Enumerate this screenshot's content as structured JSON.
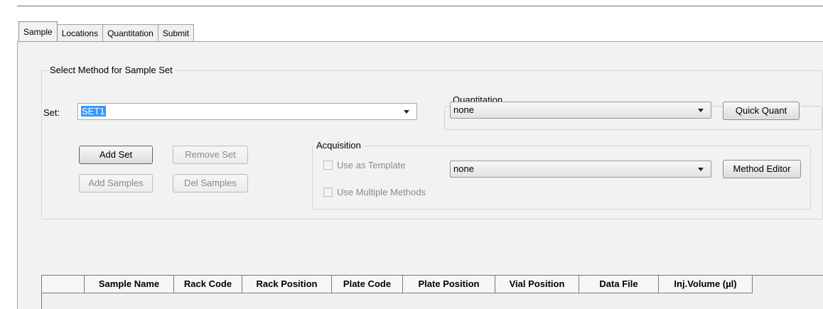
{
  "tabs": [
    "Sample",
    "Locations",
    "Quantitation",
    "Submit"
  ],
  "select_method": {
    "title": "Select Method for Sample Set",
    "set_label": "Set:",
    "set_value": "SET1",
    "buttons": {
      "add_set": "Add Set",
      "remove_set": "Remove Set",
      "add_samples": "Add Samples",
      "del_samples": "Del Samples"
    }
  },
  "quantitation": {
    "title": "Quantitation",
    "value": "none",
    "button": "Quick Quant"
  },
  "acquisition": {
    "title": "Acquisition",
    "use_as_template": "Use as Template",
    "use_multiple_methods": "Use Multiple Methods",
    "value": "none",
    "button": "Method Editor"
  },
  "table": {
    "columns": [
      "",
      "Sample Name",
      "Rack Code",
      "Rack Position",
      "Plate Code",
      "Plate Position",
      "Vial Position",
      "Data File",
      "Inj.Volume (µl)"
    ]
  },
  "colors": {
    "selection": "#3399ff",
    "panel": "#f2f2f2"
  }
}
